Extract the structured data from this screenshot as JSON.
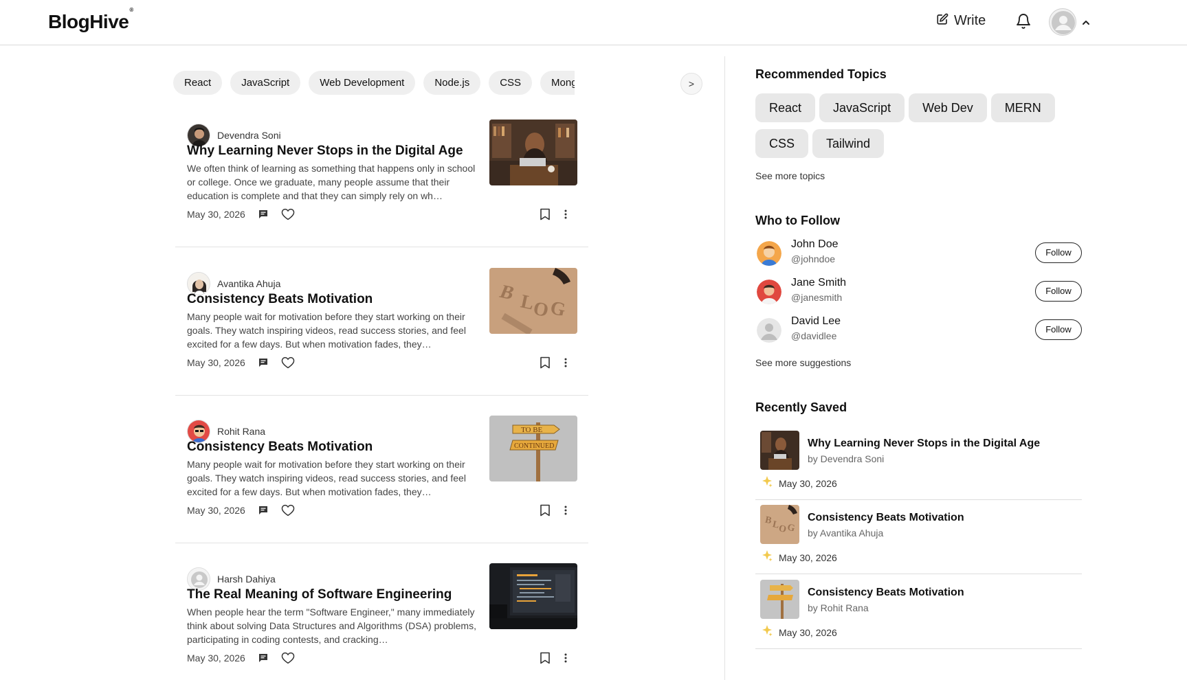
{
  "header": {
    "logo": "BlogHive",
    "logo_mark": "®",
    "write_label": "Write"
  },
  "tags": [
    "React",
    "JavaScript",
    "Web Development",
    "Node.js",
    "CSS",
    "MongoDB"
  ],
  "tags_next_label": ">",
  "articles": [
    {
      "author": "Devendra Soni",
      "title": "Why Learning Never Stops in the Digital Age",
      "excerpt": "We often think of learning as something that happens only in school or college. Once we graduate, many people assume that their education is complete and that they can simply rely on wh…",
      "date": "May 30, 2026"
    },
    {
      "author": "Avantika Ahuja",
      "title": "Consistency Beats Motivation",
      "excerpt": "Many people wait for motivation before they start working on their goals. They watch inspiring videos, read success stories, and feel excited for a few days. But when motivation fades, they…",
      "date": "May 30, 2026"
    },
    {
      "author": "Rohit Rana",
      "title": "Consistency Beats Motivation",
      "excerpt": "Many people wait for motivation before they start working on their goals. They watch inspiring videos, read success stories, and feel excited for a few days. But when motivation fades, they…",
      "date": "May 30, 2026"
    },
    {
      "author": "Harsh Dahiya",
      "title": "The Real Meaning of Software Engineering",
      "excerpt": "When people hear the term \"Software Engineer,\" many immediately think about solving Data Structures and Algorithms (DSA) problems, participating in coding contests, and cracking…",
      "date": "May 30, 2026"
    }
  ],
  "sidebar": {
    "recommended_title": "Recommended Topics",
    "topics": [
      "React",
      "JavaScript",
      "Web Dev",
      "MERN",
      "CSS",
      "Tailwind"
    ],
    "see_more_topics": "See more topics",
    "follow_title": "Who to Follow",
    "follow": [
      {
        "name": "John Doe",
        "handle": "@johndoe",
        "button": "Follow"
      },
      {
        "name": "Jane Smith",
        "handle": "@janesmith",
        "button": "Follow"
      },
      {
        "name": "David Lee",
        "handle": "@davidlee",
        "button": "Follow"
      }
    ],
    "see_more_suggestions": "See more suggestions",
    "saved_title": "Recently Saved",
    "saved": [
      {
        "title": "Why Learning Never Stops in the Digital Age",
        "by": "by Devendra Soni",
        "date": "May 30, 2026"
      },
      {
        "title": "Consistency Beats Motivation",
        "by": "by Avantika Ahuja",
        "date": "May 30, 2026"
      },
      {
        "title": "Consistency Beats Motivation",
        "by": "by Rohit Rana",
        "date": "May 30, 2026"
      }
    ]
  },
  "colors": {
    "pill_bg": "#efefef",
    "topic_bg": "#e8e8e8",
    "divider": "#e2e2e2",
    "sparkle": "#f2c94c"
  }
}
